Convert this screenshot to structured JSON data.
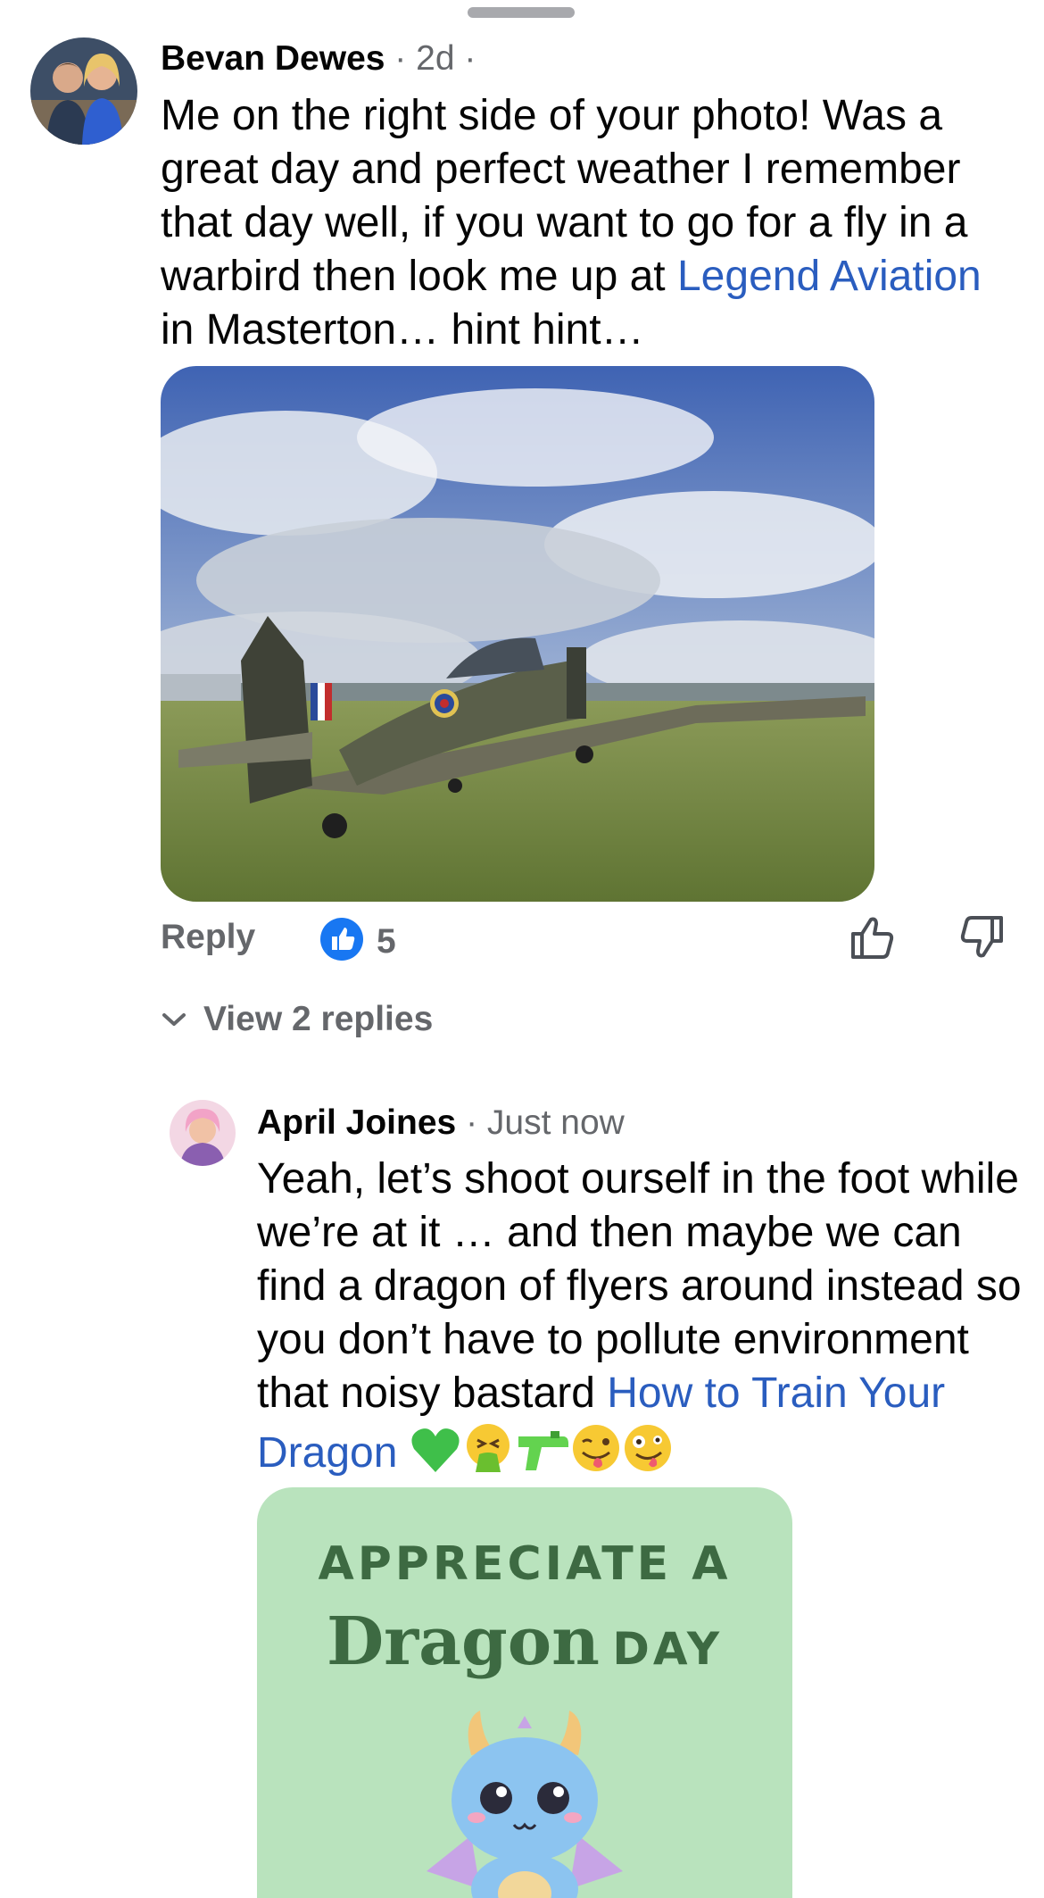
{
  "sheet": {
    "grabber": "drag-handle"
  },
  "comment1": {
    "author": "Bevan Dewes",
    "separator": " · ",
    "time": "2d",
    "trailing_dot": " ·",
    "text_before_link": "Me on the right side of your photo! Was a great day and perfect weather I remember that day well, if you want to go for a fly in a warbird then look me up at ",
    "link_text": "Legend Aviation",
    "text_after_link": " in Masterton… hint hint…",
    "image_subject": "warbird-aircraft-on-grass-airfield",
    "reply_label": "Reply",
    "like_count": "5",
    "view_replies_label": "View 2 replies"
  },
  "comment2": {
    "author": "April Joines",
    "separator": " · ",
    "time": "Just now",
    "text_before_link": "Yeah, let’s shoot ourself in the foot while we’re at it … and then maybe we can find a dragon of flyers around instead so you don’t have to pollute environment that noisy bastard ",
    "link_text": "How to Train Your Dragon",
    "emojis": [
      "green-heart-emoji",
      "vomiting-face-emoji",
      "water-pistol-emoji",
      "winking-tongue-face-emoji",
      "zany-face-emoji"
    ],
    "sticker_line1": "APPRECIATE A",
    "sticker_word": "Dragon",
    "sticker_day": "DAY"
  },
  "colors": {
    "link": "#2a5dbf",
    "meta_gray": "#65676b",
    "like_blue": "#1877f2",
    "sticker_bg": "#b9e3bd"
  }
}
